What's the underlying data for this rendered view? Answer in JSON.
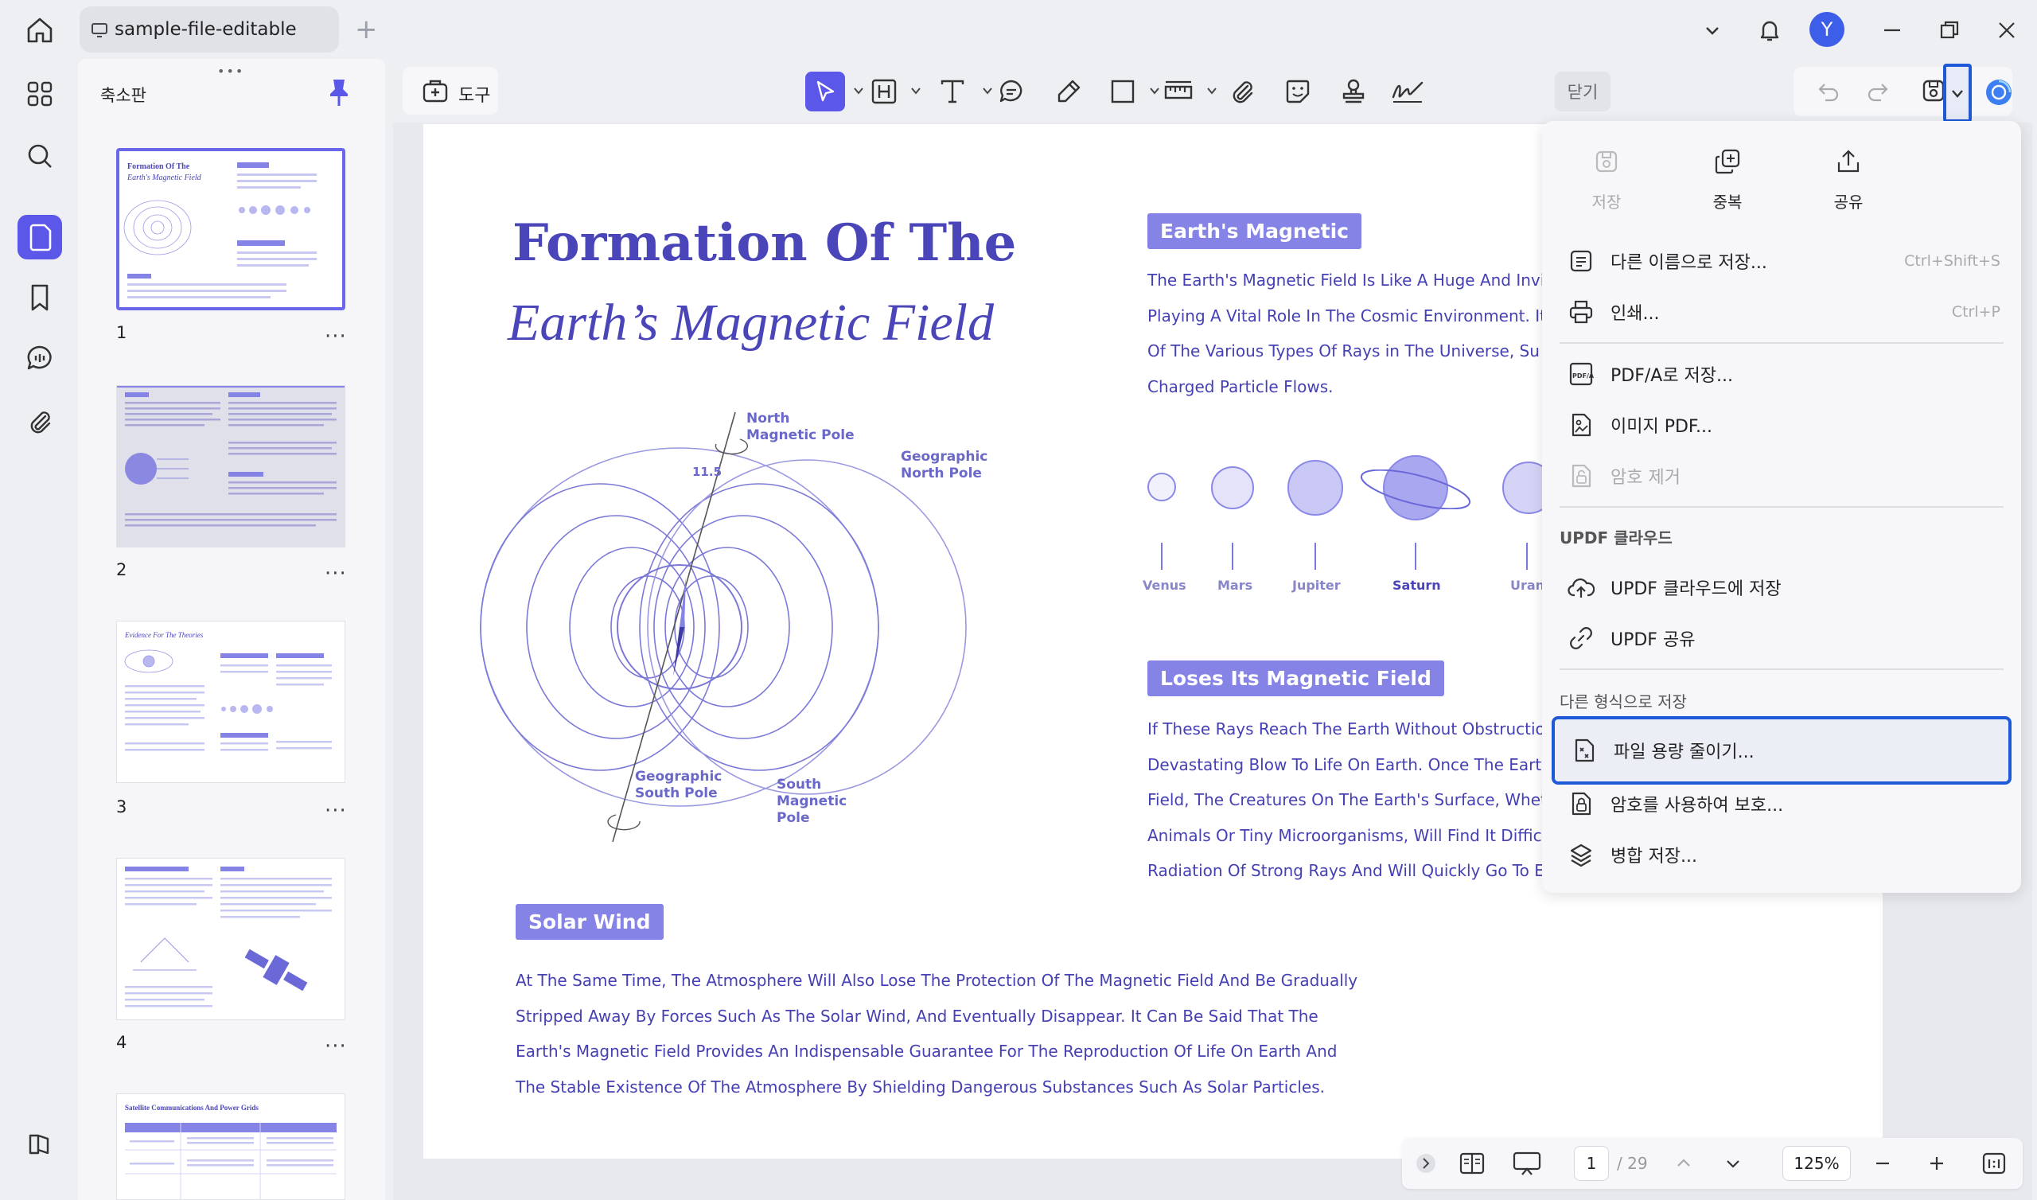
{
  "app": {
    "tab_title": "sample-file-editable",
    "avatar_initial": "Y",
    "accent_color": "#5b57e8",
    "highlight_color": "#1e5ad7"
  },
  "sidebar": {
    "panel_title": "축소판",
    "rail_icons": [
      "thumbnails-grid-icon",
      "search-icon",
      "pages-icon",
      "bookmark-icon",
      "comment-icon",
      "attachment-icon",
      "panel-toggle-icon"
    ],
    "thumbnails": [
      {
        "num": "1",
        "selected": true,
        "heading": "Formation Of The",
        "subheading": "Earth's Magnetic Field"
      },
      {
        "num": "2",
        "selected": false
      },
      {
        "num": "3",
        "selected": false,
        "heading": "Evidence For The Theories"
      },
      {
        "num": "4",
        "selected": false
      },
      {
        "num": "",
        "selected": false,
        "heading": "Satellite Communications And Power Grids"
      }
    ],
    "more": "···"
  },
  "toolbar": {
    "tools_label": "도구",
    "close_label": "닫기"
  },
  "document": {
    "title_line1": "Formation Of The",
    "title_line2": "Earth’s Magnetic Field",
    "section1_tag": "Earth's Magnetic",
    "section1_lines": [
      "The Earth's Magnetic Field Is Like A Huge And Invis",
      "Playing A Vital Role In The Cosmic Environment. It",
      "Of The Various Types Of Rays in The Universe, Su",
      "Charged Particle Flows."
    ],
    "planets": [
      "Venus",
      "Mars",
      "Jupiter",
      "Saturn",
      "Uran"
    ],
    "section2_tag": "Loses Its Magnetic Field",
    "section2_lines": [
      "If These Rays Reach The Earth Without Obstructio",
      "Devastating Blow To Life On Earth. Once The Earth",
      "Field, The Creatures On The Earth's Surface, Whet",
      "Animals Or Tiny Microorganisms, Will Find It Difficu",
      "Radiation Of Strong Rays And Will Quickly Go To E"
    ],
    "section3_tag": "Solar Wind",
    "section3_lines": [
      "At The Same Time, The Atmosphere Will Also Lose The Protection Of The Magnetic Field And Be Gradually",
      "Stripped Away By Forces Such As The Solar Wind, And Eventually Disappear. It Can Be Said That The",
      "Earth's Magnetic Field Provides An Indispensable Guarantee For The Reproduction Of Life On Earth And",
      "The Stable Existence Of The Atmosphere By Shielding Dangerous Substances Such As Solar Particles."
    ],
    "diagram": {
      "north_magnetic": [
        "North",
        "Magnetic Pole"
      ],
      "geographic_north": [
        "Geographic",
        "North Pole"
      ],
      "angle": "11.5",
      "geographic_south": [
        "Geographic",
        "South Pole"
      ],
      "south_magnetic": [
        "South",
        "Magnetic",
        "Pole"
      ]
    }
  },
  "statusbar": {
    "current_page": "1",
    "total_pages": "/ 29",
    "zoom": "125%"
  },
  "save_menu": {
    "top_actions": [
      {
        "label": "저장",
        "icon": "save-icon",
        "disabled": true
      },
      {
        "label": "중복",
        "icon": "duplicate-icon",
        "disabled": false
      },
      {
        "label": "공유",
        "icon": "share-icon",
        "disabled": false
      }
    ],
    "items": [
      {
        "label": "다른 이름으로 저장...",
        "shortcut": "Ctrl+Shift+S",
        "icon": "save-as-icon"
      },
      {
        "label": "인쇄...",
        "shortcut": "Ctrl+P",
        "icon": "print-icon"
      },
      {
        "label": "PDF/A로 저장...",
        "icon": "pdfa-icon"
      },
      {
        "label": "이미지 PDF...",
        "icon": "image-pdf-icon"
      },
      {
        "label": "암호 제거",
        "icon": "remove-password-icon",
        "disabled": true
      }
    ],
    "cloud_section": "UPDF 클라우드",
    "cloud_items": [
      {
        "label": "UPDF 클라우드에 저장",
        "icon": "cloud-upload-icon"
      },
      {
        "label": "UPDF 공유",
        "icon": "link-icon"
      }
    ],
    "format_section": "다른 형식으로 저장",
    "format_items": [
      {
        "label": "파일 용량 줄이기...",
        "icon": "compress-icon",
        "highlighted": true
      },
      {
        "label": "암호를 사용하여 보호...",
        "icon": "protect-icon"
      },
      {
        "label": "병합 저장...",
        "icon": "flatten-icon"
      }
    ]
  }
}
